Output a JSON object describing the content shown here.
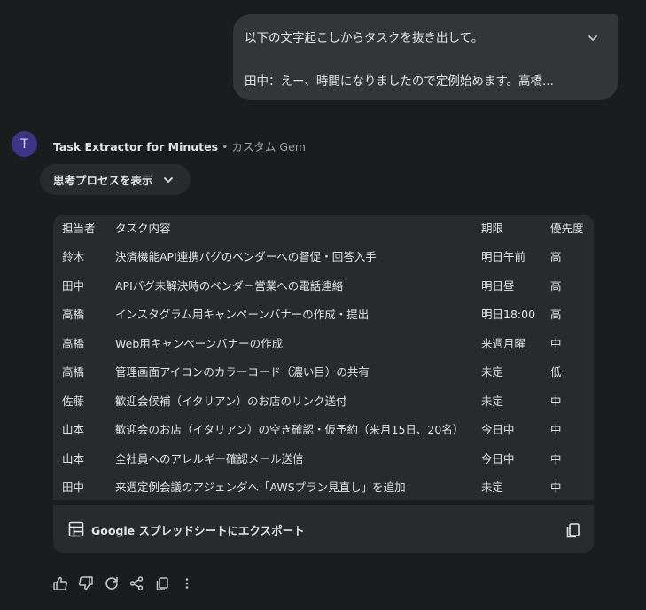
{
  "user_message": {
    "line1": "以下の文字起こしからタスクを抜き出して。",
    "line2": "田中：えー、時間になりましたので定例始めます。高橋..."
  },
  "response": {
    "avatar_letter": "T",
    "gem_name": "Task Extractor for Minutes",
    "gem_separator": "•",
    "gem_type": "カスタム Gem",
    "thinking_label": "思考プロセスを表示",
    "table": {
      "headers": [
        "担当者",
        "タスク内容",
        "期限",
        "優先度"
      ],
      "rows": [
        [
          "鈴木",
          "決済機能API連携バグのベンダーへの督促・回答入手",
          "明日午前",
          "高"
        ],
        [
          "田中",
          "APIバグ未解決時のベンダー営業への電話連絡",
          "明日昼",
          "高"
        ],
        [
          "高橋",
          "インスタグラム用キャンペーンバナーの作成・提出",
          "明日18:00",
          "高"
        ],
        [
          "高橋",
          "Web用キャンペーンバナーの作成",
          "来週月曜",
          "中"
        ],
        [
          "高橋",
          "管理画面アイコンのカラーコード（濃い目）の共有",
          "未定",
          "低"
        ],
        [
          "佐藤",
          "歓迎会候補（イタリアン）のお店のリンク送付",
          "未定",
          "中"
        ],
        [
          "山本",
          "歓迎会のお店（イタリアン）の空き確認・仮予約（来月15日、20名）",
          "今日中",
          "中"
        ],
        [
          "山本",
          "全社員へのアレルギー確認メール送信",
          "今日中",
          "中"
        ],
        [
          "田中",
          "来週定例会議のアジェンダへ「AWSプラン見直し」を追加",
          "未定",
          "中"
        ]
      ]
    },
    "export_label": "Google スプレッドシートにエクスポート"
  },
  "icons": {
    "expand": "chevron-down-icon",
    "thinking": "chevron-down-icon",
    "export": "table-icon",
    "copy_table": "copy-icon",
    "actions": [
      "thumb-up-icon",
      "thumb-down-icon",
      "regenerate-icon",
      "share-icon",
      "copy-icon",
      "more-vert-icon"
    ]
  },
  "colors": {
    "background": "#1b1c1d",
    "bubble": "#333537",
    "card": "#282a2c",
    "avatar": "#3e3486",
    "text": "#e3e3e3",
    "muted": "#9aa0a6"
  }
}
